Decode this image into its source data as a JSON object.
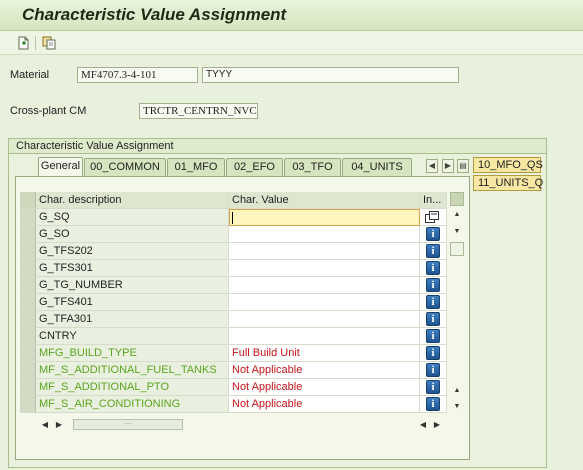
{
  "window": {
    "title": "Characteristic Value Assignment"
  },
  "toolbar": {
    "btn1_icon": "new-document-icon",
    "btn2_icon": "copy-icon"
  },
  "header": {
    "material_label": "Material",
    "material_value": "MF4707.3-4-101",
    "material_desc": "TYYY",
    "crossplant_label": "Cross-plant CM",
    "crossplant_value": "TRCTR_CENTRN_NVC"
  },
  "group": {
    "title": "Characteristic Value Assignment"
  },
  "tabs": [
    {
      "label": "General",
      "active": true
    },
    {
      "label": "00_COMMON"
    },
    {
      "label": "01_MFO"
    },
    {
      "label": "02_EFO"
    },
    {
      "label": "03_TFO"
    },
    {
      "label": "04_UNITS"
    }
  ],
  "extra_tabs": [
    "10_MFO_QS",
    "11_UNITS_Q"
  ],
  "table": {
    "columns": [
      "Char. description",
      "Char. Value",
      "In..."
    ],
    "rows": [
      {
        "desc": "G_SQ",
        "value": "",
        "style": "normal",
        "icon": "multi"
      },
      {
        "desc": "G_SO",
        "value": "",
        "style": "normal",
        "icon": "info"
      },
      {
        "desc": "G_TFS202",
        "value": "",
        "style": "normal",
        "icon": "info"
      },
      {
        "desc": "G_TFS301",
        "value": "",
        "style": "normal",
        "icon": "info"
      },
      {
        "desc": "G_TG_NUMBER",
        "value": "",
        "style": "normal",
        "icon": "info"
      },
      {
        "desc": "G_TFS401",
        "value": "",
        "style": "normal",
        "icon": "info"
      },
      {
        "desc": "G_TFA301",
        "value": "",
        "style": "normal",
        "icon": "info"
      },
      {
        "desc": "CNTRY",
        "value": "",
        "style": "normal",
        "icon": "info"
      },
      {
        "desc": "MFG_BUILD_TYPE",
        "value": "Full Build Unit",
        "style": "green",
        "icon": "info"
      },
      {
        "desc": "MF_S_ADDITIONAL_FUEL_TANKS",
        "value": "Not Applicable",
        "style": "green",
        "icon": "info"
      },
      {
        "desc": "MF_S_ADDITIONAL_PTO",
        "value": "Not Applicable",
        "style": "green",
        "icon": "info"
      },
      {
        "desc": "MF_S_AIR_CONDITIONING",
        "value": "Not Applicable",
        "style": "green",
        "icon": "info"
      }
    ]
  },
  "info_glyph": "i",
  "colors": {
    "inferred_desc": "#5aa51e",
    "assigned_value": "#c4141b",
    "focus_cell": "#fff6bf"
  }
}
